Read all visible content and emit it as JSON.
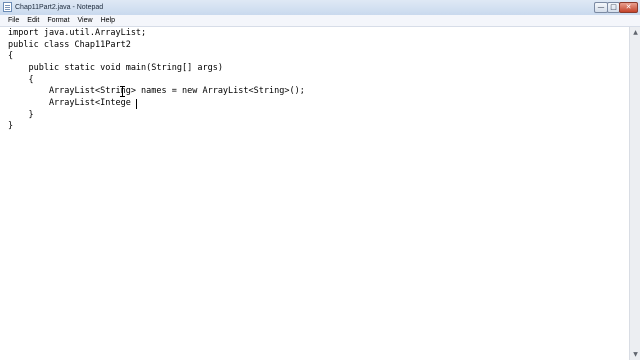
{
  "window": {
    "title": "Chap11Part2.java - Notepad",
    "controls": {
      "minimize": "—",
      "maximize": "□",
      "close": "✕"
    }
  },
  "menu": [
    "File",
    "Edit",
    "Format",
    "View",
    "Help"
  ],
  "editor": {
    "lines": [
      "import java.util.ArrayList;",
      "public class Chap11Part2",
      "{",
      "",
      "    public static void main(String[] args)",
      "    {",
      "        ArrayList<String> names = new ArrayList<String>();",
      "        ArrayList<Intege",
      "    }",
      "}"
    ]
  },
  "scrollbar": {
    "up_icon": "▲",
    "down_icon": "▼"
  }
}
